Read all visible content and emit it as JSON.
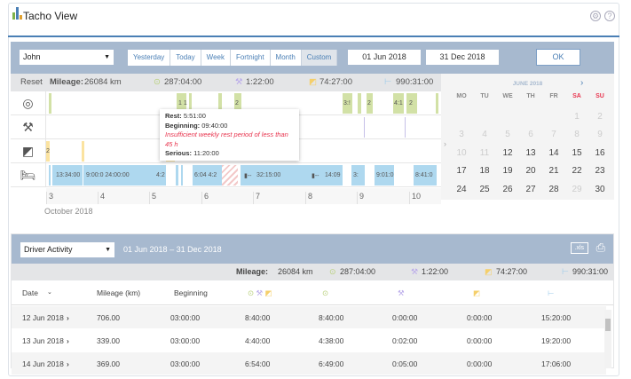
{
  "app": {
    "title": "Tacho View",
    "settings_icon": "gear-icon",
    "help_icon": "help-icon"
  },
  "toolbar": {
    "driver": "John",
    "periods": [
      "Yesterday",
      "Today",
      "Week",
      "Fortnight",
      "Month",
      "Custom"
    ],
    "active_period": "Custom",
    "date_from": "01 Jun 2018",
    "date_to": "31 Dec 2018",
    "ok": "OK"
  },
  "summary": {
    "reset": "Reset",
    "mileage_label": "Mileage:",
    "mileage": "26084 km",
    "driving": "287:04:00",
    "work": "1:22:00",
    "availability": "74:27:00",
    "rest": "990:31:00"
  },
  "timeline": {
    "drive_labels": [
      "1 1",
      "2",
      "3:!",
      "2",
      "4:1",
      "2"
    ],
    "rest_labels": [
      "13:34:00",
      "9:00:0 24:00:00",
      "4:2",
      "6:04 4:2",
      "32:15:00",
      "14:09",
      "3:",
      "9:01:0",
      "8:41:0"
    ],
    "other_labels": [
      "2"
    ],
    "days": [
      "3",
      "4",
      "5",
      "6",
      "7",
      "8",
      "9",
      "10"
    ],
    "month": "October 2018"
  },
  "tooltip": {
    "rest_label": "Rest:",
    "rest": "5:51:00",
    "beginning_label": "Beginning:",
    "beginning": "09:40:00",
    "warning": "Insufficient weekly rest period of less than 45 h",
    "serious_label": "Serious:",
    "serious": "11:20:00"
  },
  "calendar": {
    "month": "JUNE 2018",
    "weekdays": [
      "MO",
      "TU",
      "WE",
      "TH",
      "FR",
      "SA",
      "SU"
    ],
    "days": [
      [
        "",
        "",
        "",
        "",
        "",
        "1",
        "2"
      ],
      [
        "3",
        "4",
        "5",
        "6",
        "7",
        "8",
        "9"
      ],
      [
        "10",
        "11",
        "12",
        "13",
        "14",
        "15",
        "16"
      ],
      [
        "17",
        "18",
        "19",
        "20",
        "21",
        "22",
        "23"
      ],
      [
        "24",
        "25",
        "26",
        "27",
        "28",
        "29",
        "30"
      ]
    ],
    "disabled": [
      "1",
      "2",
      "3",
      "4",
      "5",
      "6",
      "7",
      "8",
      "9",
      "10",
      "11",
      "29"
    ]
  },
  "report": {
    "type": "Driver Activity",
    "range_from": "01 Jun 2018",
    "range_sep": "–",
    "range_to": "31 Dec 2018",
    "xls": ".xls",
    "summary": {
      "mileage_label": "Mileage:",
      "mileage": "26084 km",
      "driving": "287:04:00",
      "work": "1:22:00",
      "availability": "74:27:00",
      "rest": "990:31:00"
    },
    "columns": [
      "Date",
      "Mileage (km)",
      "Beginning"
    ],
    "rows": [
      [
        "12 Jun 2018",
        "706.00",
        "03:00:00",
        "8:40:00",
        "8:40:00",
        "0:00:00",
        "0:00:00",
        "15:20:00"
      ],
      [
        "13 Jun 2018",
        "339.00",
        "03:00:00",
        "4:40:00",
        "4:38:00",
        "0:02:00",
        "0:00:00",
        "19:20:00"
      ],
      [
        "14 Jun 2018",
        "369.00",
        "03:00:00",
        "6:54:00",
        "6:49:00",
        "0:05:00",
        "0:00:00",
        "17:06:00"
      ]
    ]
  },
  "colors": {
    "accent": "#4a7fb5",
    "toolbar": "#a7b9cf",
    "drive": "#d2e1a6",
    "rest": "#aed8ef",
    "available": "#fbe3a0",
    "work": "#b9a9ea",
    "warning": "#e8344e"
  }
}
